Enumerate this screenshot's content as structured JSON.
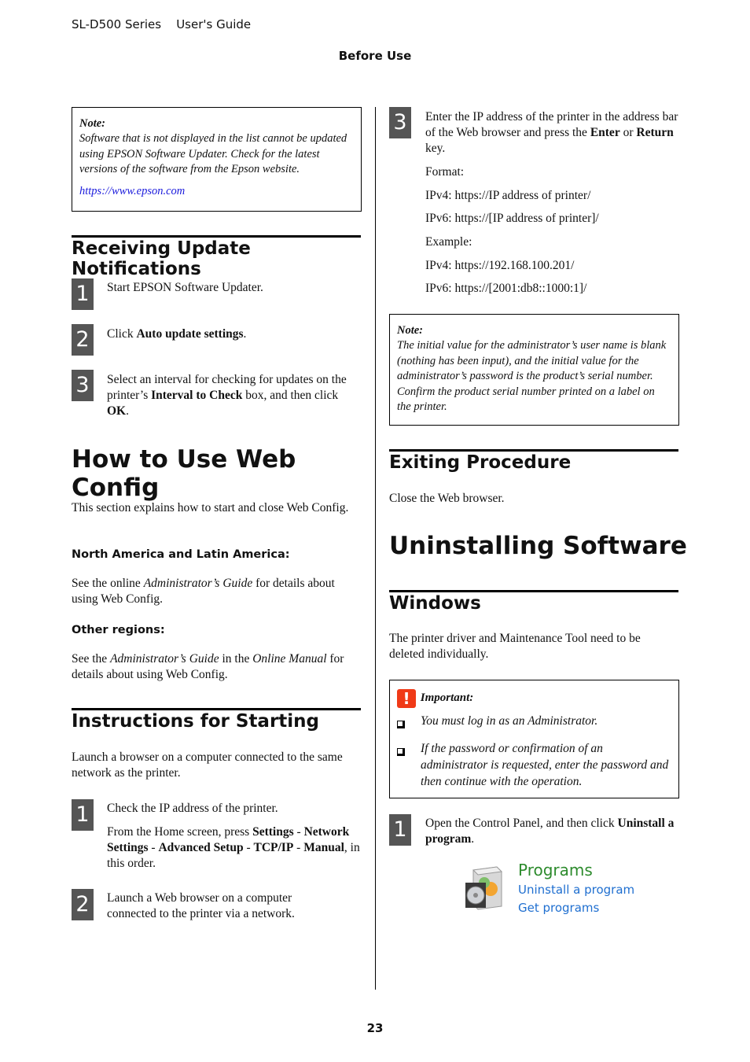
{
  "header": {
    "product": "SL-D500 Series",
    "guide": "User's Guide",
    "section": "Before Use"
  },
  "footer": {
    "page_number": "23"
  },
  "left": {
    "note1": {
      "title": "Note:",
      "text": "Software that is not displayed in the list cannot be updated using EPSON Software Updater. Check for the latest versions of the software from the Epson website.",
      "link": "https://www.epson.com"
    },
    "receiving": {
      "heading": "Receiving Update Notifications",
      "steps": [
        {
          "num": "1",
          "text": "Start EPSON Software Updater."
        },
        {
          "num": "2",
          "pre": "Click ",
          "bold": "Auto update settings",
          "post": "."
        },
        {
          "num": "3",
          "pre": "Select an interval for checking for updates on the printer’s ",
          "bold": "Interval to Check",
          "mid": " box, and then click ",
          "bold2": "OK",
          "post": "."
        }
      ]
    },
    "webconfig": {
      "heading": "How to Use Web Config",
      "intro": "This section explains how to start and close Web Config.",
      "na_heading": "North America and Latin America:",
      "na_pre": "See the online ",
      "na_italic": "Administrator’s Guide",
      "na_post": " for details about using Web Config.",
      "other_heading": "Other regions:",
      "other_pre": "See the ",
      "other_italic1": "Administrator’s Guide",
      "other_mid": " in the ",
      "other_italic2": "Online Manual",
      "other_post": " for details about using Web Config."
    },
    "starting": {
      "heading": "Instructions for Starting",
      "intro": "Launch a browser on a computer connected to the same network as the printer.",
      "step1": {
        "num": "1",
        "text": "Check the IP address of the printer.",
        "sub_pre": "From the Home screen, press ",
        "b1": "Settings",
        "s1": " - ",
        "b2": "Network Settings",
        "s2": " - ",
        "b3": "Advanced Setup",
        "s3": " - ",
        "b4": "TCP/IP",
        "s4": " - ",
        "b5": "Manual",
        "sub_post": ", in this order."
      },
      "step2": {
        "num": "2",
        "text": "Launch a Web browser on a computer connected to the printer via a network."
      }
    }
  },
  "right": {
    "step3": {
      "num": "3",
      "pre": "Enter the IP address of the printer in the address bar of the Web browser and press the ",
      "b1": "Enter",
      "mid": " or ",
      "b2": "Return",
      "post": " key.",
      "lines": [
        "Format:",
        "IPv4: https://IP address of printer/",
        "IPv6: https://[IP address of printer]/",
        "Example:",
        "IPv4: https://192.168.100.201/",
        "IPv6: https://[2001:db8::1000:1]/"
      ]
    },
    "note2": {
      "title": "Note:",
      "text": "The initial value for the administrator’s user name is blank (nothing has been input), and the initial value for the administrator’s password is the product’s serial number. Confirm the product serial number printed on a label on the printer."
    },
    "exiting": {
      "heading": "Exiting Procedure",
      "text": "Close the Web browser."
    },
    "uninstall": {
      "heading": "Uninstalling Software",
      "windows_heading": "Windows",
      "windows_text": "The printer driver and Maintenance Tool need to be deleted individually.",
      "important": {
        "icon": "!",
        "title": "Important:",
        "items": [
          "You must log in as an Administrator.",
          "If the password or confirmation of an administrator is requested, enter the password and then continue with the operation."
        ]
      },
      "step1": {
        "num": "1",
        "pre": "Open the Control Panel, and then click ",
        "bold": "Uninstall a program",
        "post": "."
      },
      "programs_panel": {
        "title": "Programs",
        "links": [
          "Uninstall a program",
          "Get programs"
        ]
      }
    }
  },
  "colors": {
    "link": "#1a1adc",
    "step_badge": "#555555",
    "important_icon": "#f03a17",
    "programs_title": "#2d8b2d",
    "programs_link": "#1f6fd0"
  }
}
